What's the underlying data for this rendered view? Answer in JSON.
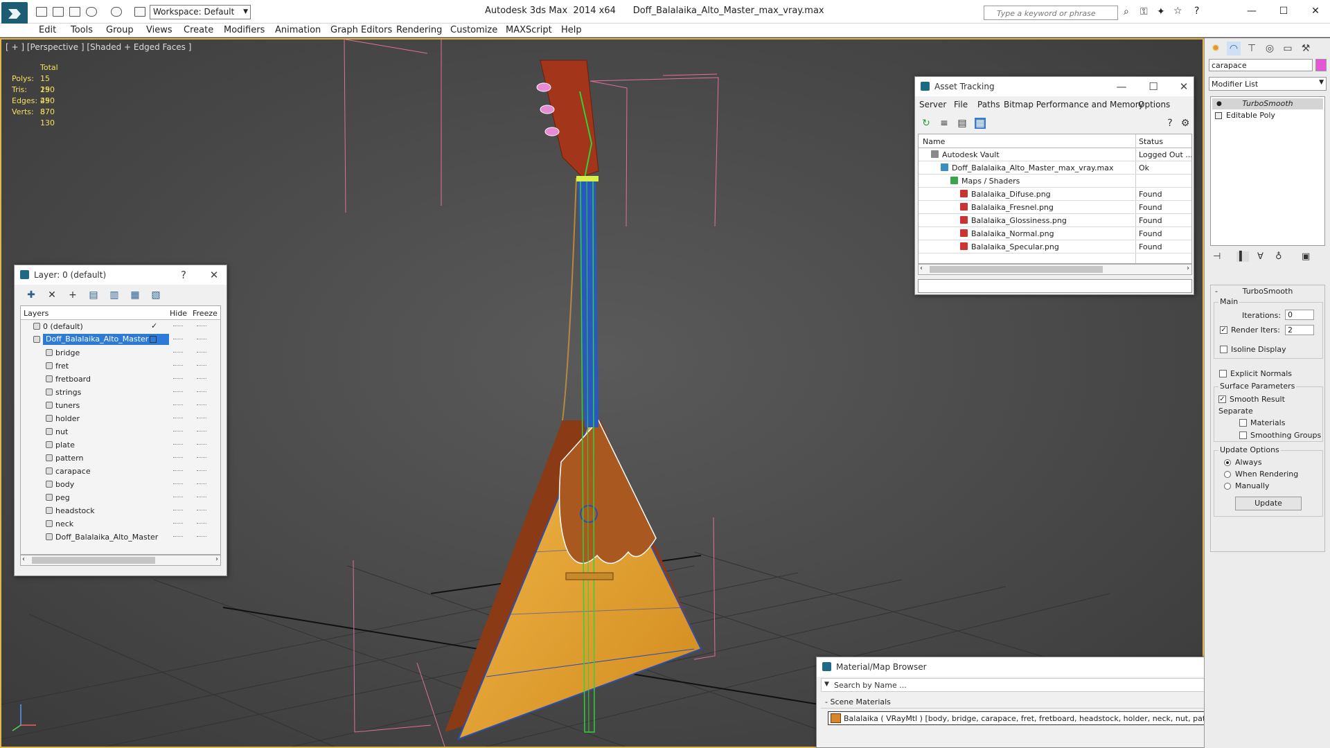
{
  "title": {
    "app": "Autodesk 3ds Max  2014 x64",
    "file": "Doff_Balalaika_Alto_Master_max_vray.max",
    "workspace": "Workspace: Default",
    "search_placeholder": "Type a keyword or phrase"
  },
  "menu": [
    "Edit",
    "Tools",
    "Group",
    "Views",
    "Create",
    "Modifiers",
    "Animation",
    "Graph Editors",
    "Rendering",
    "Customize",
    "MAXScript",
    "Help"
  ],
  "viewport": {
    "label": "[ + ] [Perspective ] [Shaded + Edged Faces ]",
    "stats": {
      "header": "Total",
      "rows": [
        {
          "label": "Polys:",
          "value": "15 290"
        },
        {
          "label": "Tris:",
          "value": "15 290"
        },
        {
          "label": "Edges:",
          "value": "45 870"
        },
        {
          "label": "Verts:",
          "value": "8 130"
        }
      ]
    }
  },
  "layer_dialog": {
    "title": "Layer: 0 (default)",
    "help": "?",
    "columns": {
      "layers": "Layers",
      "hide": "Hide",
      "freeze": "Freeze"
    },
    "rows": [
      {
        "name": "0 (default)",
        "level": 0,
        "checked": true
      },
      {
        "name": "Doff_Balalaika_Alto_Master",
        "level": 0,
        "selected": true
      },
      {
        "name": "bridge",
        "level": 1
      },
      {
        "name": "fret",
        "level": 1
      },
      {
        "name": "fretboard",
        "level": 1
      },
      {
        "name": "strings",
        "level": 1
      },
      {
        "name": "tuners",
        "level": 1
      },
      {
        "name": "holder",
        "level": 1
      },
      {
        "name": "nut",
        "level": 1
      },
      {
        "name": "plate",
        "level": 1
      },
      {
        "name": "pattern",
        "level": 1
      },
      {
        "name": "carapace",
        "level": 1
      },
      {
        "name": "body",
        "level": 1
      },
      {
        "name": "peg",
        "level": 1
      },
      {
        "name": "headstock",
        "level": 1
      },
      {
        "name": "neck",
        "level": 1
      },
      {
        "name": "Doff_Balalaika_Alto_Master",
        "level": 1
      }
    ]
  },
  "asset_dialog": {
    "title": "Asset Tracking",
    "menu": [
      "Server",
      "File",
      "Paths",
      "Bitmap Performance and Memory",
      "Options"
    ],
    "columns": {
      "name": "Name",
      "status": "Status"
    },
    "rows": [
      {
        "name": "Autodesk Vault",
        "status": "Logged Out ...",
        "indent": 18,
        "color": "#8a8a8a"
      },
      {
        "name": "Doff_Balalaika_Alto_Master_max_vray.max",
        "status": "Ok",
        "indent": 32,
        "color": "#3a8fc0"
      },
      {
        "name": "Maps / Shaders",
        "status": "",
        "indent": 46,
        "color": "#3aa54a"
      },
      {
        "name": "Balalaika_Difuse.png",
        "status": "Found",
        "indent": 60,
        "color": "#c33"
      },
      {
        "name": "Balalaika_Fresnel.png",
        "status": "Found",
        "indent": 60,
        "color": "#c33"
      },
      {
        "name": "Balalaika_Glossiness.png",
        "status": "Found",
        "indent": 60,
        "color": "#c33"
      },
      {
        "name": "Balalaika_Normal.png",
        "status": "Found",
        "indent": 60,
        "color": "#c33"
      },
      {
        "name": "Balalaika_Specular.png",
        "status": "Found",
        "indent": 60,
        "color": "#c33"
      }
    ]
  },
  "material_browser": {
    "title": "Material/Map Browser",
    "search_placeholder": "Search by Name ...",
    "section": "- Scene Materials",
    "item": "Balalaika  ( VRayMtl ) [body, bridge, carapace, fret, fretboard, headstock, holder, neck, nut, pattern, peg, plate, strings, tuners]"
  },
  "command_panel": {
    "object_name": "carapace",
    "object_color": "#e356d6",
    "modifier_list": "Modifier List",
    "stack": [
      "TurboSmooth",
      "Editable Poly"
    ],
    "turbosmooth": {
      "title": "TurboSmooth",
      "main": "Main",
      "iterations_label": "Iterations:",
      "iterations": "0",
      "render_iters_label": "Render Iters:",
      "render_iters": "2",
      "isoline": "Isoline Display",
      "explicit": "Explicit Normals",
      "surface": "Surface Parameters",
      "smooth_result": "Smooth Result",
      "separate": "Separate",
      "materials": "Materials",
      "smoothing_groups": "Smoothing Groups",
      "update_options": "Update Options",
      "always": "Always",
      "when_rendering": "When Rendering",
      "manually": "Manually",
      "update": "Update"
    }
  }
}
